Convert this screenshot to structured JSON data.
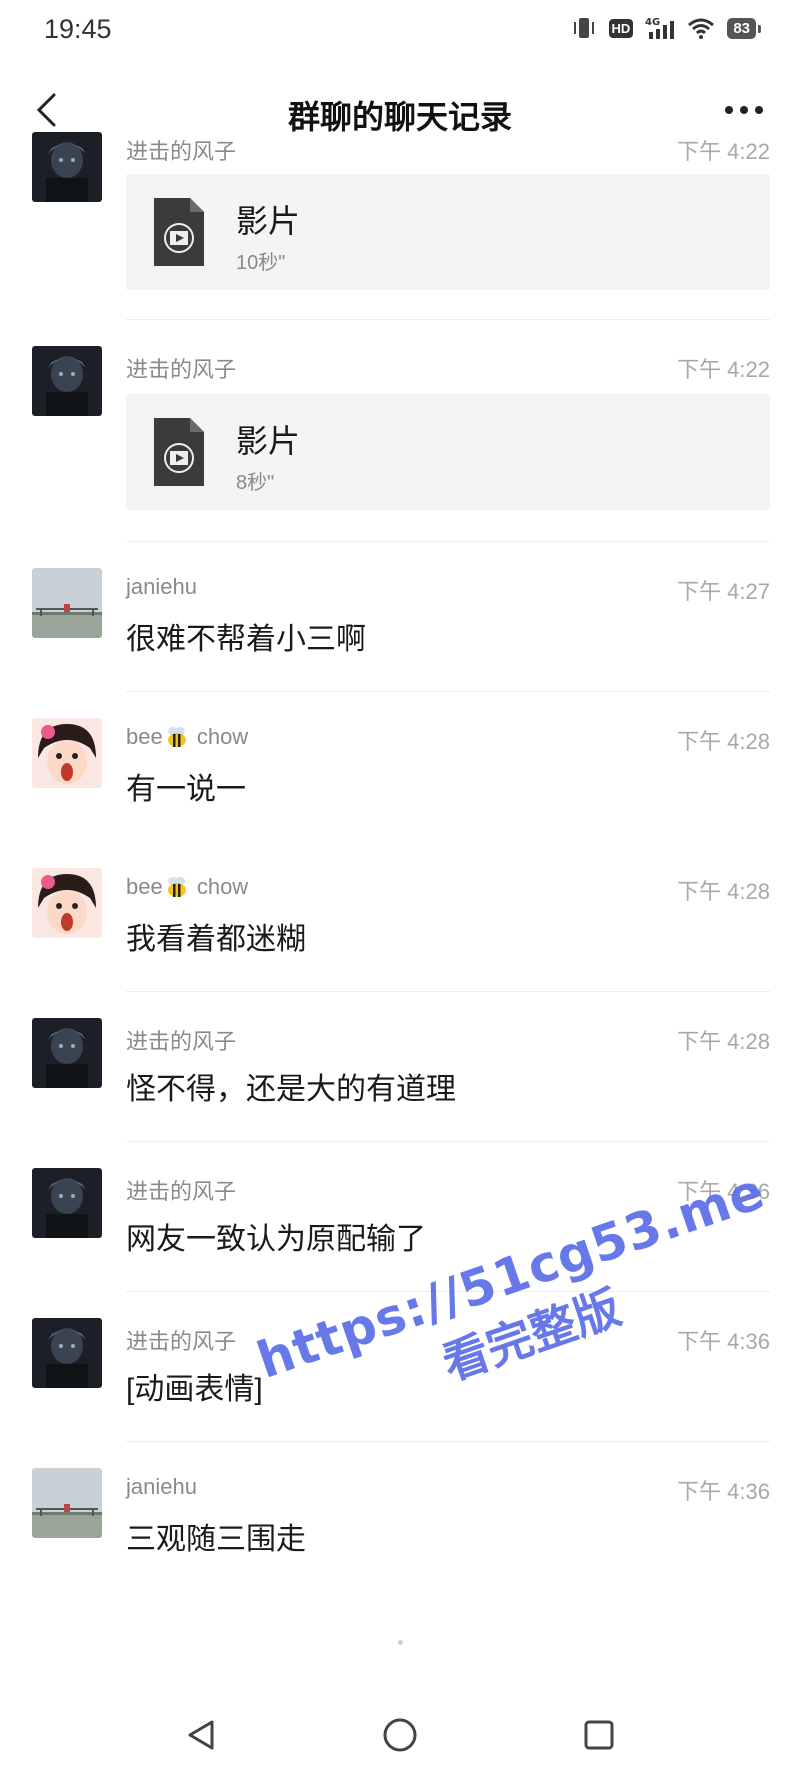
{
  "status_bar": {
    "time": "19:45",
    "network": "4G",
    "hd_label": "HD",
    "battery": "83"
  },
  "header": {
    "title": "群聊的聊天记录",
    "back_icon": "chevron-left-icon",
    "more_icon": "more-dots-icon"
  },
  "messages": [
    {
      "sender": "进击的风子",
      "time": "下午 4:22",
      "type": "file",
      "file_title": "影片",
      "file_duration": "10秒\"",
      "avatar": "dark-figure"
    },
    {
      "sender": "进击的风子",
      "time": "下午 4:22",
      "type": "file",
      "file_title": "影片",
      "file_duration": "8秒\"",
      "avatar": "dark-figure"
    },
    {
      "sender": "janiehu",
      "time": "下午 4:27",
      "type": "text",
      "text": "很难不帮着小三啊",
      "avatar": "landscape"
    },
    {
      "sender_prefix": "bee",
      "sender_suffix": " chow",
      "sender_emoji": "bee-icon",
      "time": "下午 4:28",
      "type": "text",
      "text": "有一说一",
      "avatar": "cartoon-girl"
    },
    {
      "sender_prefix": "bee",
      "sender_suffix": " chow",
      "sender_emoji": "bee-icon",
      "time": "下午 4:28",
      "type": "text",
      "text": "我看着都迷糊",
      "avatar": "cartoon-girl"
    },
    {
      "sender": "进击的风子",
      "time": "下午 4:28",
      "type": "text",
      "text": "怪不得，还是大的有道理",
      "avatar": "dark-figure"
    },
    {
      "sender": "进击的风子",
      "time": "下午 4:36",
      "type": "text",
      "text": "网友一致认为原配输了",
      "avatar": "dark-figure"
    },
    {
      "sender": "进击的风子",
      "time": "下午 4:36",
      "type": "text",
      "text": "[动画表情]",
      "avatar": "dark-figure"
    },
    {
      "sender": "janiehu",
      "time": "下午 4:36",
      "type": "text",
      "text": "三观随三围走",
      "avatar": "landscape"
    }
  ],
  "watermark": {
    "url": "https://51cg53.me",
    "subtitle": "看完整版"
  },
  "nav_bar": {
    "back_icon": "triangle-back-icon",
    "home_icon": "circle-home-icon",
    "recents_icon": "square-recents-icon"
  },
  "colors": {
    "background": "#ffffff",
    "sender": "#8a8a8a",
    "timestamp": "#a8a8a8",
    "file_card": "#f4f4f4",
    "divider": "#ececec",
    "watermark": "#5b6ee8"
  }
}
